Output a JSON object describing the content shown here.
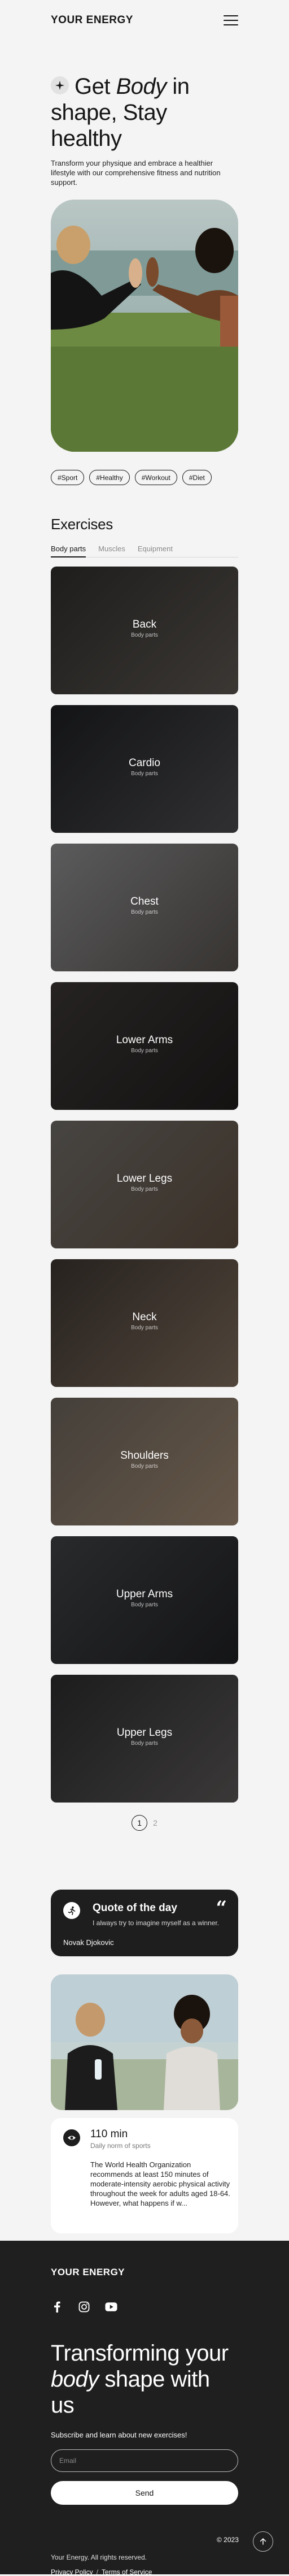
{
  "header": {
    "logo": "YOUR ENERGY",
    "menu_icon": "hamburger-menu-icon"
  },
  "hero": {
    "title_pre": "Get ",
    "title_em": "Body",
    "title_post": " in shape, Stay healthy",
    "subtitle": "Transform your physique and embrace a healthier lifestyle with our comprehensive fitness and nutrition support.",
    "badge_icon": "sparkle-icon",
    "tags": [
      "#Sport",
      "#Healthy",
      "#Workout",
      "#Diet"
    ]
  },
  "exercises": {
    "title": "Exercises",
    "tabs": [
      {
        "label": "Body parts",
        "active": true
      },
      {
        "label": "Muscles",
        "active": false
      },
      {
        "label": "Equipment",
        "active": false
      }
    ],
    "cards": [
      {
        "name": "Back",
        "category": "Body parts",
        "colors": [
          "#2f2e2c",
          "#5b5550"
        ]
      },
      {
        "name": "Cardio",
        "category": "Body parts",
        "colors": [
          "#1e1f22",
          "#4a4a4e"
        ]
      },
      {
        "name": "Chest",
        "category": "Body parts",
        "colors": [
          "#8c8c8e",
          "#55504c"
        ]
      },
      {
        "name": "Lower Arms",
        "category": "Body parts",
        "colors": [
          "#3a3634",
          "#1f1d1c"
        ]
      },
      {
        "name": "Lower Legs",
        "category": "Body parts",
        "colors": [
          "#6d6a66",
          "#5d4d3f"
        ]
      },
      {
        "name": "Neck",
        "category": "Body parts",
        "colors": [
          "#3c3530",
          "#7c6a5a"
        ]
      },
      {
        "name": "Shoulders",
        "category": "Body parts",
        "colors": [
          "#6a625a",
          "#9c8670"
        ]
      },
      {
        "name": "Upper Arms",
        "category": "Body parts",
        "colors": [
          "#3f4144",
          "#1f2022"
        ]
      },
      {
        "name": "Upper Legs",
        "category": "Body parts",
        "colors": [
          "#2c2c2e",
          "#5a5756"
        ]
      }
    ],
    "pagination": {
      "current": "1",
      "next": "2"
    }
  },
  "quote": {
    "title": "Quote of the day",
    "text": "I always try to imagine myself as a winner.",
    "author": "Novak Djokovic",
    "icon": "running-man-icon",
    "mark": "“"
  },
  "stat": {
    "value": "110 min",
    "caption": "Daily norm of sports",
    "text": "The World Health Organization recommends at least 150 minutes of moderate-intensity aerobic physical activity throughout the week for adults aged 18-64. However, what happens if w...",
    "icon": "eye-icon"
  },
  "footer": {
    "logo": "YOUR ENERGY",
    "socials": [
      "facebook-icon",
      "instagram-icon",
      "youtube-icon"
    ],
    "title_line1": "Transforming your",
    "title_em": "body",
    "title_rest": " shape with us",
    "subscribe_text": "Subscribe and learn about new exercises!",
    "email_placeholder": "Email",
    "send_label": "Send",
    "rights": "Your Energy. All rights reserved.",
    "privacy": "Privacy Policy",
    "separator": "/",
    "terms": "Terms of Service",
    "copyright": "© 2023"
  }
}
